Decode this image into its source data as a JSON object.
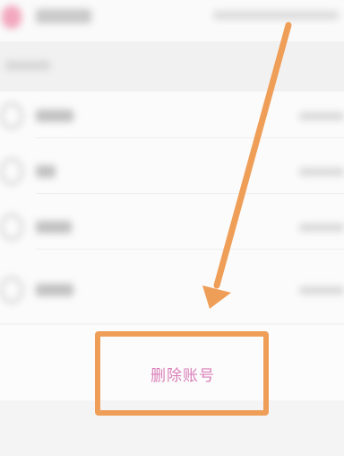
{
  "account": {
    "delete_label": "删除账号"
  },
  "annotation": {
    "color": "#ef9e58",
    "type": "arrow-and-box"
  },
  "accent_color": "#d97fb8"
}
